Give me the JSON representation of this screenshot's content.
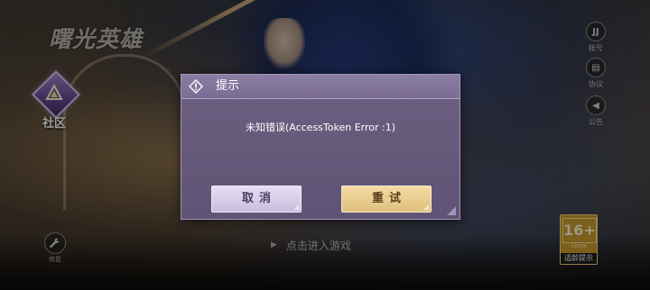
{
  "logo": {
    "text": "曙光英雄",
    "subtitle": ""
  },
  "community": {
    "label": "社区",
    "icon": "community-triangle-icon"
  },
  "side_buttons": [
    {
      "id": "account",
      "label": "账号",
      "icon": "account-icon",
      "glyph": "JJ"
    },
    {
      "id": "agreement",
      "label": "协议",
      "icon": "document-icon",
      "glyph": "▤"
    },
    {
      "id": "notice",
      "label": "公告",
      "icon": "megaphone-icon",
      "glyph": "◀"
    }
  ],
  "repair": {
    "label": "修复",
    "icon": "wrench-icon"
  },
  "enter_game": {
    "label": "点击进入游戏",
    "icon": "play-arrow-icon"
  },
  "age_rating": {
    "number": "16+",
    "cadpa": "CADPA",
    "tip": "适龄提示"
  },
  "legal_text": "",
  "dialog": {
    "title": "提示",
    "title_icon": "exclamation-diamond-icon",
    "message": "未知错误(AccessToken Error :1)",
    "cancel_label": "取消",
    "retry_label": "重试"
  },
  "colors": {
    "dialog_body": "#6d6081",
    "dialog_titlebar": "#8b7ea3",
    "cancel_button": "#d8cfe8",
    "retry_button": "#ecd197",
    "age_badge": "#c79a2c"
  }
}
